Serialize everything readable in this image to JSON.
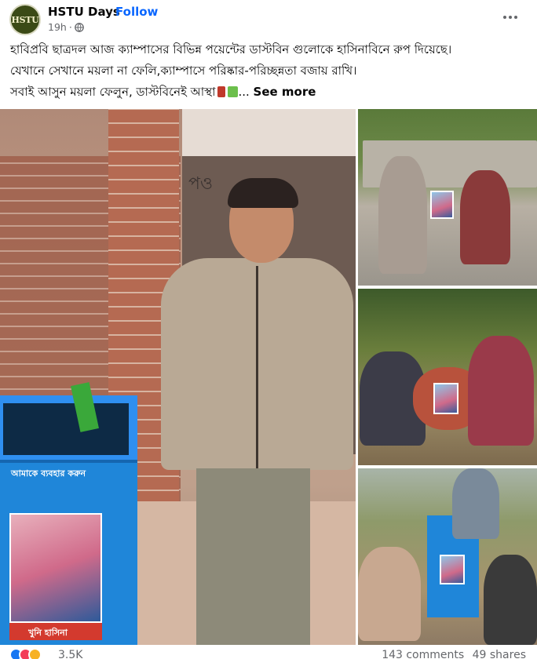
{
  "post": {
    "page_name": "HSTU Days",
    "follow_label": "Follow",
    "separator": "·",
    "time": "19h",
    "time_separator": "·",
    "avatar_text": "HSTU",
    "caption_lines": [
      "হাবিপ্রবি ছাত্রদল আজ ক্যাম্পাসের বিভিন্ন পয়েন্টের  ডাস্টবিন গুলোকে হাসিনাবিনে রুপ দিয়েছে।",
      "যেখানে সেখানে ময়লা না ফেলি,ক্যাম্পাসে পরিষ্কার-পরিচ্ছন্নতা বজায় রাখি।",
      "সবাই আসুন ময়লা ফেলুন, ডাস্টবিনেই আস্থা"
    ],
    "ellipsis": "...",
    "see_more": "See more"
  },
  "photos": {
    "main": {
      "door_sign": "পও",
      "bin_label": "আমাকে ব্যবহার করুন",
      "poster_caption": "খুনি হাসিনা"
    }
  },
  "footer": {
    "reaction_count": "3.5K",
    "comments": "143 comments",
    "shares": "49 shares"
  },
  "colors": {
    "follow": "#0866ff",
    "secondary_text": "#65676b",
    "like": "#1877f2",
    "love": "#f33e58",
    "haha": "#f7b125"
  },
  "icons": [
    "globe-icon",
    "more-icon",
    "like-icon",
    "love-icon",
    "haha-icon"
  ]
}
